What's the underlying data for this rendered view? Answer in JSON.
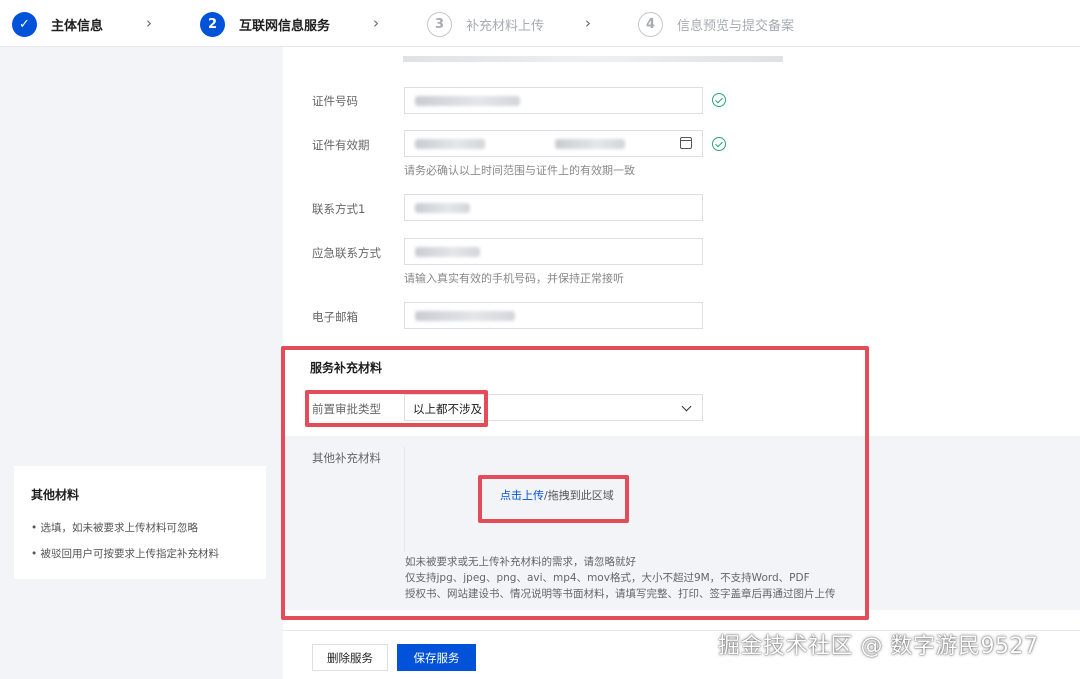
{
  "stepper": {
    "steps": [
      {
        "index": "✓",
        "label": "主体信息",
        "state": "done"
      },
      {
        "index": "2",
        "label": "互联网信息服务",
        "state": "active"
      },
      {
        "index": "3",
        "label": "补充材料上传",
        "state": "todo"
      },
      {
        "index": "4",
        "label": "信息预览与提交备案",
        "state": "todo"
      }
    ]
  },
  "form": {
    "cert_number_label": "证件号码",
    "cert_validity_label": "证件有效期",
    "cert_validity_help": "请务必确认以上时间范围与证件上的有效期一致",
    "contact1_label": "联系方式1",
    "emergency_label": "应急联系方式",
    "emergency_help": "请输入真实有效的手机号码，并保持正常接听",
    "email_label": "电子邮箱"
  },
  "supplement": {
    "title": "服务补充材料",
    "approval_type_label": "前置审批类型",
    "approval_type_value": "以上都不涉及",
    "other_materials_label": "其他补充材料",
    "upload_link": "点击上传",
    "upload_rest": "/拖拽到此区域",
    "notes": [
      "如未被要求或无上传补充材料的需求，请忽略就好",
      "仅支持jpg、jpeg、png、avi、mp4、mov格式，大小不超过9M，不支持Word、PDF",
      "授权书、网站建设书、情况说明等书面材料，请填写完整、打印、签字盖章后再通过图片上传"
    ]
  },
  "footer": {
    "delete_label": "删除服务",
    "save_label": "保存服务"
  },
  "side_card": {
    "title": "其他材料",
    "items": [
      "选填，如未被要求上传材料可忽略",
      "被驳回用户可按要求上传指定补充材料"
    ]
  },
  "watermark": "掘金技术社区 @ 数字游民9527",
  "colors": {
    "primary": "#0052d9",
    "success": "#2ba471",
    "annotation": "#e34d59"
  }
}
